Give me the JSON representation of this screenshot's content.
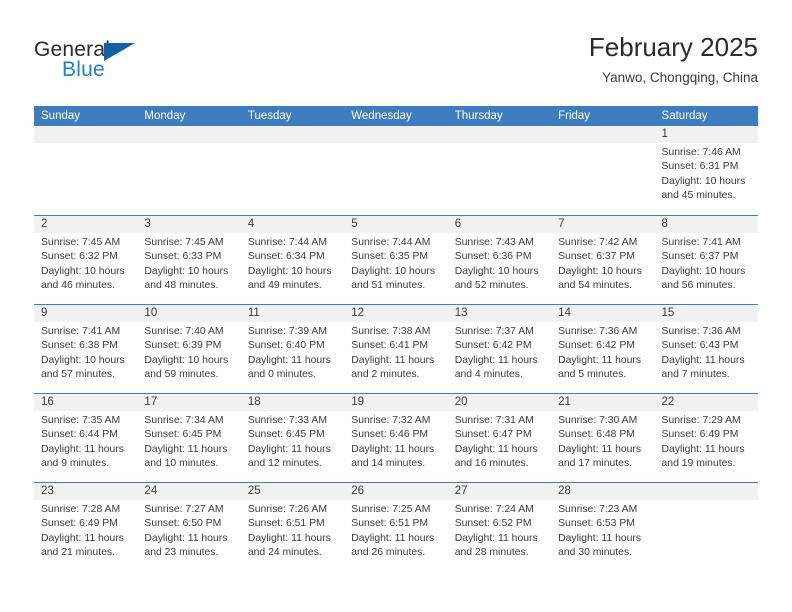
{
  "brand": {
    "word_one": "General",
    "word_two": "Blue",
    "triangle_color": "#1061a8",
    "blue_color": "#1f7fd0"
  },
  "header": {
    "title": "February 2025",
    "subtitle": "Yanwo, Chongqing, China"
  },
  "theme": {
    "header_blue": "#3d7cbf",
    "day_band_gray": "#f1f1f1",
    "text": "#3a3a3a"
  },
  "weekdays": [
    "Sunday",
    "Monday",
    "Tuesday",
    "Wednesday",
    "Thursday",
    "Friday",
    "Saturday"
  ],
  "weeks": [
    [
      {
        "day": "",
        "empty": true
      },
      {
        "day": "",
        "empty": true
      },
      {
        "day": "",
        "empty": true
      },
      {
        "day": "",
        "empty": true
      },
      {
        "day": "",
        "empty": true
      },
      {
        "day": "",
        "empty": true
      },
      {
        "day": "1",
        "sunrise": "Sunrise: 7:46 AM",
        "sunset": "Sunset: 6:31 PM",
        "daylight_1": "Daylight: 10 hours",
        "daylight_2": "and 45 minutes."
      }
    ],
    [
      {
        "day": "2",
        "sunrise": "Sunrise: 7:45 AM",
        "sunset": "Sunset: 6:32 PM",
        "daylight_1": "Daylight: 10 hours",
        "daylight_2": "and 46 minutes."
      },
      {
        "day": "3",
        "sunrise": "Sunrise: 7:45 AM",
        "sunset": "Sunset: 6:33 PM",
        "daylight_1": "Daylight: 10 hours",
        "daylight_2": "and 48 minutes."
      },
      {
        "day": "4",
        "sunrise": "Sunrise: 7:44 AM",
        "sunset": "Sunset: 6:34 PM",
        "daylight_1": "Daylight: 10 hours",
        "daylight_2": "and 49 minutes."
      },
      {
        "day": "5",
        "sunrise": "Sunrise: 7:44 AM",
        "sunset": "Sunset: 6:35 PM",
        "daylight_1": "Daylight: 10 hours",
        "daylight_2": "and 51 minutes."
      },
      {
        "day": "6",
        "sunrise": "Sunrise: 7:43 AM",
        "sunset": "Sunset: 6:36 PM",
        "daylight_1": "Daylight: 10 hours",
        "daylight_2": "and 52 minutes."
      },
      {
        "day": "7",
        "sunrise": "Sunrise: 7:42 AM",
        "sunset": "Sunset: 6:37 PM",
        "daylight_1": "Daylight: 10 hours",
        "daylight_2": "and 54 minutes."
      },
      {
        "day": "8",
        "sunrise": "Sunrise: 7:41 AM",
        "sunset": "Sunset: 6:37 PM",
        "daylight_1": "Daylight: 10 hours",
        "daylight_2": "and 56 minutes."
      }
    ],
    [
      {
        "day": "9",
        "sunrise": "Sunrise: 7:41 AM",
        "sunset": "Sunset: 6:38 PM",
        "daylight_1": "Daylight: 10 hours",
        "daylight_2": "and 57 minutes."
      },
      {
        "day": "10",
        "sunrise": "Sunrise: 7:40 AM",
        "sunset": "Sunset: 6:39 PM",
        "daylight_1": "Daylight: 10 hours",
        "daylight_2": "and 59 minutes."
      },
      {
        "day": "11",
        "sunrise": "Sunrise: 7:39 AM",
        "sunset": "Sunset: 6:40 PM",
        "daylight_1": "Daylight: 11 hours",
        "daylight_2": "and 0 minutes."
      },
      {
        "day": "12",
        "sunrise": "Sunrise: 7:38 AM",
        "sunset": "Sunset: 6:41 PM",
        "daylight_1": "Daylight: 11 hours",
        "daylight_2": "and 2 minutes."
      },
      {
        "day": "13",
        "sunrise": "Sunrise: 7:37 AM",
        "sunset": "Sunset: 6:42 PM",
        "daylight_1": "Daylight: 11 hours",
        "daylight_2": "and 4 minutes."
      },
      {
        "day": "14",
        "sunrise": "Sunrise: 7:36 AM",
        "sunset": "Sunset: 6:42 PM",
        "daylight_1": "Daylight: 11 hours",
        "daylight_2": "and 5 minutes."
      },
      {
        "day": "15",
        "sunrise": "Sunrise: 7:36 AM",
        "sunset": "Sunset: 6:43 PM",
        "daylight_1": "Daylight: 11 hours",
        "daylight_2": "and 7 minutes."
      }
    ],
    [
      {
        "day": "16",
        "sunrise": "Sunrise: 7:35 AM",
        "sunset": "Sunset: 6:44 PM",
        "daylight_1": "Daylight: 11 hours",
        "daylight_2": "and 9 minutes."
      },
      {
        "day": "17",
        "sunrise": "Sunrise: 7:34 AM",
        "sunset": "Sunset: 6:45 PM",
        "daylight_1": "Daylight: 11 hours",
        "daylight_2": "and 10 minutes."
      },
      {
        "day": "18",
        "sunrise": "Sunrise: 7:33 AM",
        "sunset": "Sunset: 6:45 PM",
        "daylight_1": "Daylight: 11 hours",
        "daylight_2": "and 12 minutes."
      },
      {
        "day": "19",
        "sunrise": "Sunrise: 7:32 AM",
        "sunset": "Sunset: 6:46 PM",
        "daylight_1": "Daylight: 11 hours",
        "daylight_2": "and 14 minutes."
      },
      {
        "day": "20",
        "sunrise": "Sunrise: 7:31 AM",
        "sunset": "Sunset: 6:47 PM",
        "daylight_1": "Daylight: 11 hours",
        "daylight_2": "and 16 minutes."
      },
      {
        "day": "21",
        "sunrise": "Sunrise: 7:30 AM",
        "sunset": "Sunset: 6:48 PM",
        "daylight_1": "Daylight: 11 hours",
        "daylight_2": "and 17 minutes."
      },
      {
        "day": "22",
        "sunrise": "Sunrise: 7:29 AM",
        "sunset": "Sunset: 6:49 PM",
        "daylight_1": "Daylight: 11 hours",
        "daylight_2": "and 19 minutes."
      }
    ],
    [
      {
        "day": "23",
        "sunrise": "Sunrise: 7:28 AM",
        "sunset": "Sunset: 6:49 PM",
        "daylight_1": "Daylight: 11 hours",
        "daylight_2": "and 21 minutes."
      },
      {
        "day": "24",
        "sunrise": "Sunrise: 7:27 AM",
        "sunset": "Sunset: 6:50 PM",
        "daylight_1": "Daylight: 11 hours",
        "daylight_2": "and 23 minutes."
      },
      {
        "day": "25",
        "sunrise": "Sunrise: 7:26 AM",
        "sunset": "Sunset: 6:51 PM",
        "daylight_1": "Daylight: 11 hours",
        "daylight_2": "and 24 minutes."
      },
      {
        "day": "26",
        "sunrise": "Sunrise: 7:25 AM",
        "sunset": "Sunset: 6:51 PM",
        "daylight_1": "Daylight: 11 hours",
        "daylight_2": "and 26 minutes."
      },
      {
        "day": "27",
        "sunrise": "Sunrise: 7:24 AM",
        "sunset": "Sunset: 6:52 PM",
        "daylight_1": "Daylight: 11 hours",
        "daylight_2": "and 28 minutes."
      },
      {
        "day": "28",
        "sunrise": "Sunrise: 7:23 AM",
        "sunset": "Sunset: 6:53 PM",
        "daylight_1": "Daylight: 11 hours",
        "daylight_2": "and 30 minutes."
      },
      {
        "day": "",
        "empty": true
      }
    ]
  ]
}
